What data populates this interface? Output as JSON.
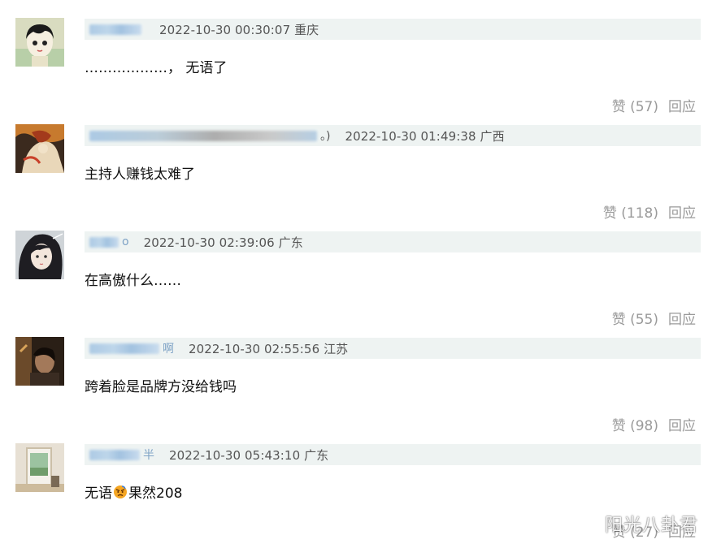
{
  "comments": [
    {
      "username_suffix": "",
      "meta": "2022-10-30 00:30:07 重庆",
      "text": "………………， 无语了",
      "like_label": "赞 (57)",
      "reply_label": "回应"
    },
    {
      "username_suffix": "。)",
      "meta": "2022-10-30 01:49:38 广西",
      "text": "主持人赚钱太难了",
      "like_label": "赞 (118)",
      "reply_label": "回应"
    },
    {
      "username_suffix": "o",
      "meta": "2022-10-30 02:39:06 广东",
      "text": "在高傲什么……",
      "like_label": "赞 (55)",
      "reply_label": "回应"
    },
    {
      "username_suffix": "啊",
      "meta": "2022-10-30 02:55:56 江苏",
      "text": "跨着脸是品牌方没给钱吗",
      "like_label": "赞 (98)",
      "reply_label": "回应"
    },
    {
      "username_suffix": "半",
      "meta": "2022-10-30 05:43:10 广东",
      "text_before": "无语",
      "emoji": "angry-face-emoji",
      "text_after": "果然208",
      "like_label": "赞 (27)",
      "reply_label": "回应"
    }
  ],
  "watermark": "阳光八卦君",
  "colors": {
    "header_bg": "#eef3f2",
    "username_blur": "#a9c8e4",
    "action_text": "#9a9a9a"
  }
}
